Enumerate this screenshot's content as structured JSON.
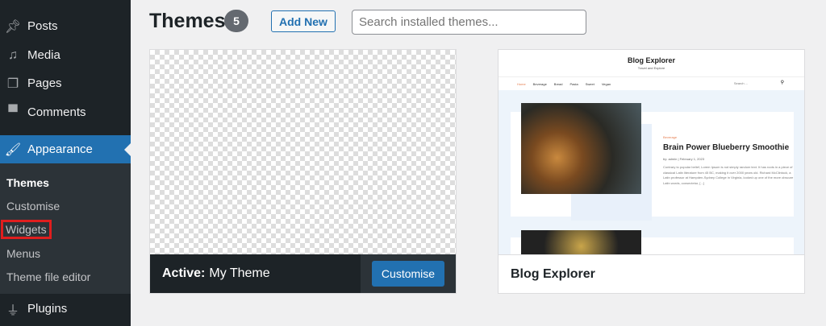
{
  "sidebar": {
    "items": [
      {
        "label": "Posts",
        "icon": "pin-icon"
      },
      {
        "label": "Media",
        "icon": "media-icon"
      },
      {
        "label": "Pages",
        "icon": "pages-icon"
      },
      {
        "label": "Comments",
        "icon": "comment-icon"
      },
      {
        "label": "Appearance",
        "icon": "paintbrush-icon"
      },
      {
        "label": "Plugins",
        "icon": "plug-icon"
      }
    ],
    "submenu": [
      "Themes",
      "Customise",
      "Widgets",
      "Menus",
      "Theme file editor"
    ]
  },
  "header": {
    "title": "Themes",
    "count": "5",
    "add_new": "Add New",
    "search_placeholder": "Search installed themes..."
  },
  "themes": [
    {
      "active_label": "Active:",
      "name": "My Theme",
      "customise": "Customise"
    },
    {
      "name": "Blog Explorer",
      "preview": {
        "site_title": "Blog Explorer",
        "tagline": "Travel and Explore",
        "nav": [
          "Home",
          "Beverage",
          "Bread",
          "Pasta",
          "Sweet",
          "Vegan"
        ],
        "search": "Search ...",
        "category": "Beverage",
        "post_title": "Brain Power Blueberry Smoothie",
        "meta": "by: admin  |  February 1, 2023",
        "excerpt": "Contrary to popular belief, Lorem Ipsum is not simply random text. It has roots in a piece of classical Latin literature from 45 BC, making it over 2000 years old. Richard McClintock, a Latin professor at Hampden-Sydney College in Virginia, looked up one of the more obscure Latin words, consectetur, [...]"
      }
    }
  ]
}
